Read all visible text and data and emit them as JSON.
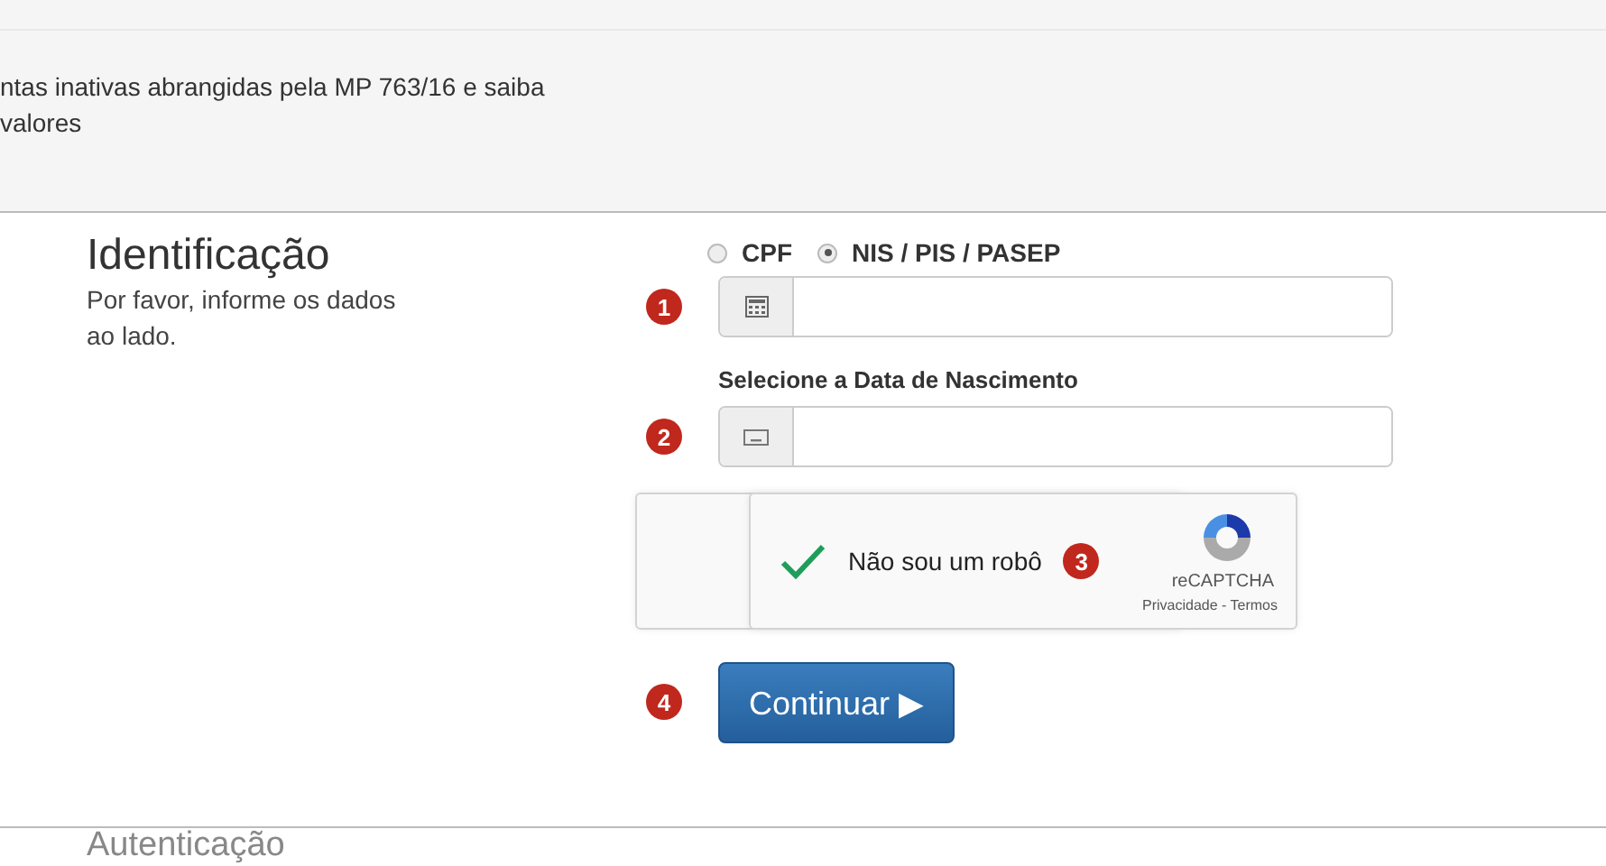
{
  "intro_lines": [
    "ntas inativas abrangidas pela MP 763/16 e saiba",
    "valores"
  ],
  "section": {
    "title": "Identificação",
    "description": "Por favor, informe os dados ao lado."
  },
  "id_type": [
    {
      "label": "CPF",
      "selected": false
    },
    {
      "label": "NIS / PIS / PASEP",
      "selected": true
    }
  ],
  "steps": [
    {
      "number": "1",
      "kind": "id-input"
    },
    {
      "number": "2",
      "kind": "date-input",
      "label": "Selecione a Data de Nascimento"
    },
    {
      "number": "3",
      "kind": "captcha"
    },
    {
      "number": "4",
      "kind": "submit"
    }
  ],
  "captcha": {
    "checked": true,
    "label": "Não sou um robô",
    "brand": "reCAPTCHA",
    "links": "Privacidade - Termos"
  },
  "submit": {
    "label": "Continuar",
    "arrow": "▶"
  },
  "next_section": {
    "title": "Autenticação"
  }
}
